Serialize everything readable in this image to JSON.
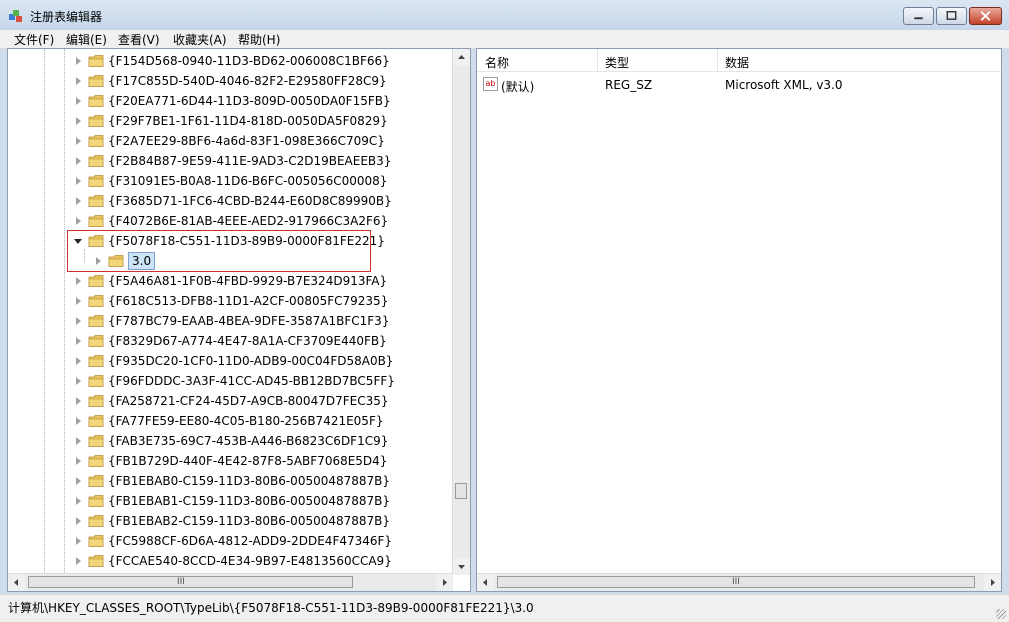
{
  "window": {
    "title": "注册表编辑器"
  },
  "menu": [
    "文件(F)",
    "编辑(E)",
    "查看(V)",
    "收藏夹(A)",
    "帮助(H)"
  ],
  "tree": {
    "items": [
      "{F154D568-0940-11D3-BD62-006008C1BF66}",
      "{F17C855D-540D-4046-82F2-E29580FF28C9}",
      "{F20EA771-6D44-11D3-809D-0050DA0F15FB}",
      "{F29F7BE1-1F61-11D4-818D-0050DA5F0829}",
      "{F2A7EE29-8BF6-4a6d-83F1-098E366C709C}",
      "{F2B84B87-9E59-411E-9AD3-C2D19BEAEEB3}",
      "{F31091E5-B0A8-11D6-B6FC-005056C00008}",
      "{F3685D71-1FC6-4CBD-B244-E60D8C89990B}",
      "{F4072B6E-81AB-4EEE-AED2-917966C3A2F6}",
      "{F5078F18-C551-11D3-89B9-0000F81FE221}",
      "3.0",
      "{F5A46A81-1F0B-4FBD-9929-B7E324D913FA}",
      "{F618C513-DFB8-11D1-A2CF-00805FC79235}",
      "{F787BC79-EAAB-4BEA-9DFE-3587A1BFC1F3}",
      "{F8329D67-A774-4E47-8A1A-CF3709E440FB}",
      "{F935DC20-1CF0-11D0-ADB9-00C04FD58A0B}",
      "{F96FDDDC-3A3F-41CC-AD45-BB12BD7BC5FF}",
      "{FA258721-CF24-45D7-A9CB-80047D7FEC35}",
      "{FA77FE59-EE80-4C05-B180-256B7421E05F}",
      "{FAB3E735-69C7-453B-A446-B6823C6DF1C9}",
      "{FB1B729D-440F-4E42-87F8-5ABF7068E5D4}",
      "{FB1EBAB0-C159-11D3-80B6-00500487887B}",
      "{FB1EBAB1-C159-11D3-80B6-00500487887B}",
      "{FB1EBAB2-C159-11D3-80B6-00500487887B}",
      "{FC5988CF-6D6A-4812-ADD9-2DDE4F47346F}",
      "{FCCAE540-8CCD-4E34-9B97-E4813560CCA9}"
    ],
    "expanded_item": "{F5078F18-C551-11D3-89B9-0000F81FE221}",
    "selected_item": "3.0"
  },
  "values": {
    "headers": [
      "名称",
      "类型",
      "数据"
    ],
    "rows": [
      {
        "icon": "ab",
        "name": "(默认)",
        "type": "REG_SZ",
        "data": "Microsoft XML, v3.0"
      }
    ]
  },
  "scrollbar": {
    "grip": "III"
  },
  "status": {
    "path": "计算机\\HKEY_CLASSES_ROOT\\TypeLib\\{F5078F18-C551-11D3-89B9-0000F81FE221}\\3.0"
  },
  "icons": [
    "registry-editor-icon",
    "minimize-icon",
    "maximize-icon",
    "close-icon",
    "folder-icon",
    "string-value-icon"
  ],
  "colors": {
    "selection": "#cde3f7",
    "highlight_box": "#d03030",
    "folder": "#e8c25a"
  }
}
